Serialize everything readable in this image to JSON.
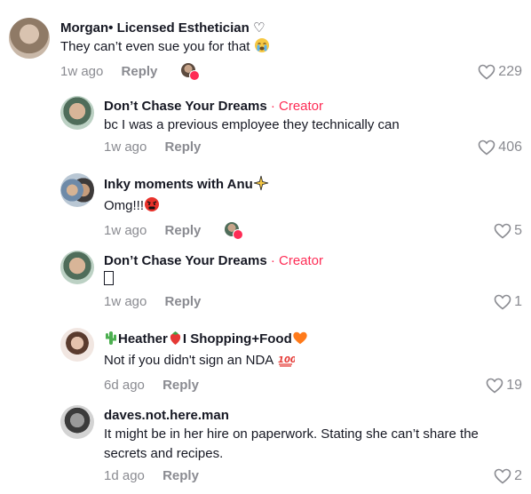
{
  "comments": [
    {
      "name": "Morgan• Licensed Esthetician ♡",
      "text": "They can’t even sue you for that",
      "time": "1w ago",
      "reply": "Reply",
      "likes": "229"
    },
    {
      "name": "Don’t Chase Your Dreams",
      "badge": "· Creator",
      "text": "bc I was a previous employee they technically can",
      "time": "1w ago",
      "reply": "Reply",
      "likes": "406"
    },
    {
      "name": "Inky moments with Anu",
      "text": "Omg!!!",
      "time": "1w ago",
      "reply": "Reply",
      "likes": "5"
    },
    {
      "name": "Don’t Chase Your Dreams",
      "badge": "· Creator",
      "text": "",
      "time": "1w ago",
      "reply": "Reply",
      "likes": "1"
    },
    {
      "name_part1": "Heather",
      "name_part2": "I Shopping+Food",
      "text": "Not if you didn't sign an NDA",
      "time": "6d ago",
      "reply": "Reply",
      "likes": "19"
    },
    {
      "name": "daves.not.here.man",
      "text": "It might be in her hire on paperwork. Stating she can’t share the secrets and recipes.",
      "time": "1d ago",
      "reply": "Reply",
      "likes": "2"
    }
  ],
  "colors": {
    "creator": "#fe2c55",
    "muted": "#8a8b91",
    "text": "#161823"
  }
}
